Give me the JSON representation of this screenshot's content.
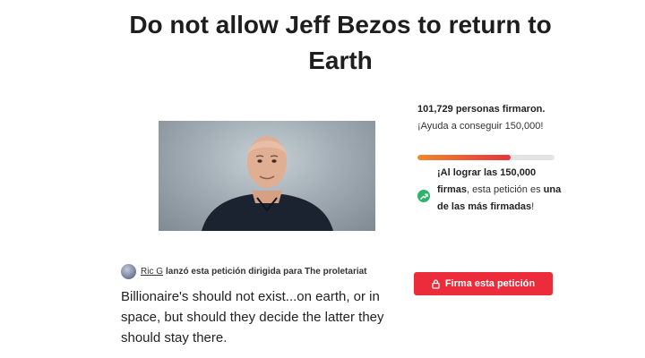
{
  "petition": {
    "title": "Do not allow Jeff Bezos to return to Earth",
    "description": "Billionaire's should not exist...on earth, or in space, but should they decide the latter they should stay there."
  },
  "creator": {
    "name": "Ric G",
    "action_prefix": "lanzó esta petición dirigida para",
    "target": "The proletariat"
  },
  "signatures": {
    "count_text": "101,729 personas firmaron.",
    "goal_text": "¡Ayuda a conseguir 150,000!",
    "progress_fraction": 0.68
  },
  "milestone": {
    "part1": "¡Al lograr las 150,000 firmas",
    "part2": ", esta petición es ",
    "part3": "una de las más firmadas",
    "part4": "!"
  },
  "sign_button": {
    "label": "Firma esta petición"
  },
  "icons": {
    "lock": "lock-icon",
    "trend": "trending-up-icon",
    "avatar": "creator-avatar"
  },
  "colors": {
    "primary": "#ec2c3a",
    "success": "#2db46a",
    "progress_start": "#ee8a2a",
    "progress_end": "#e8363b"
  }
}
